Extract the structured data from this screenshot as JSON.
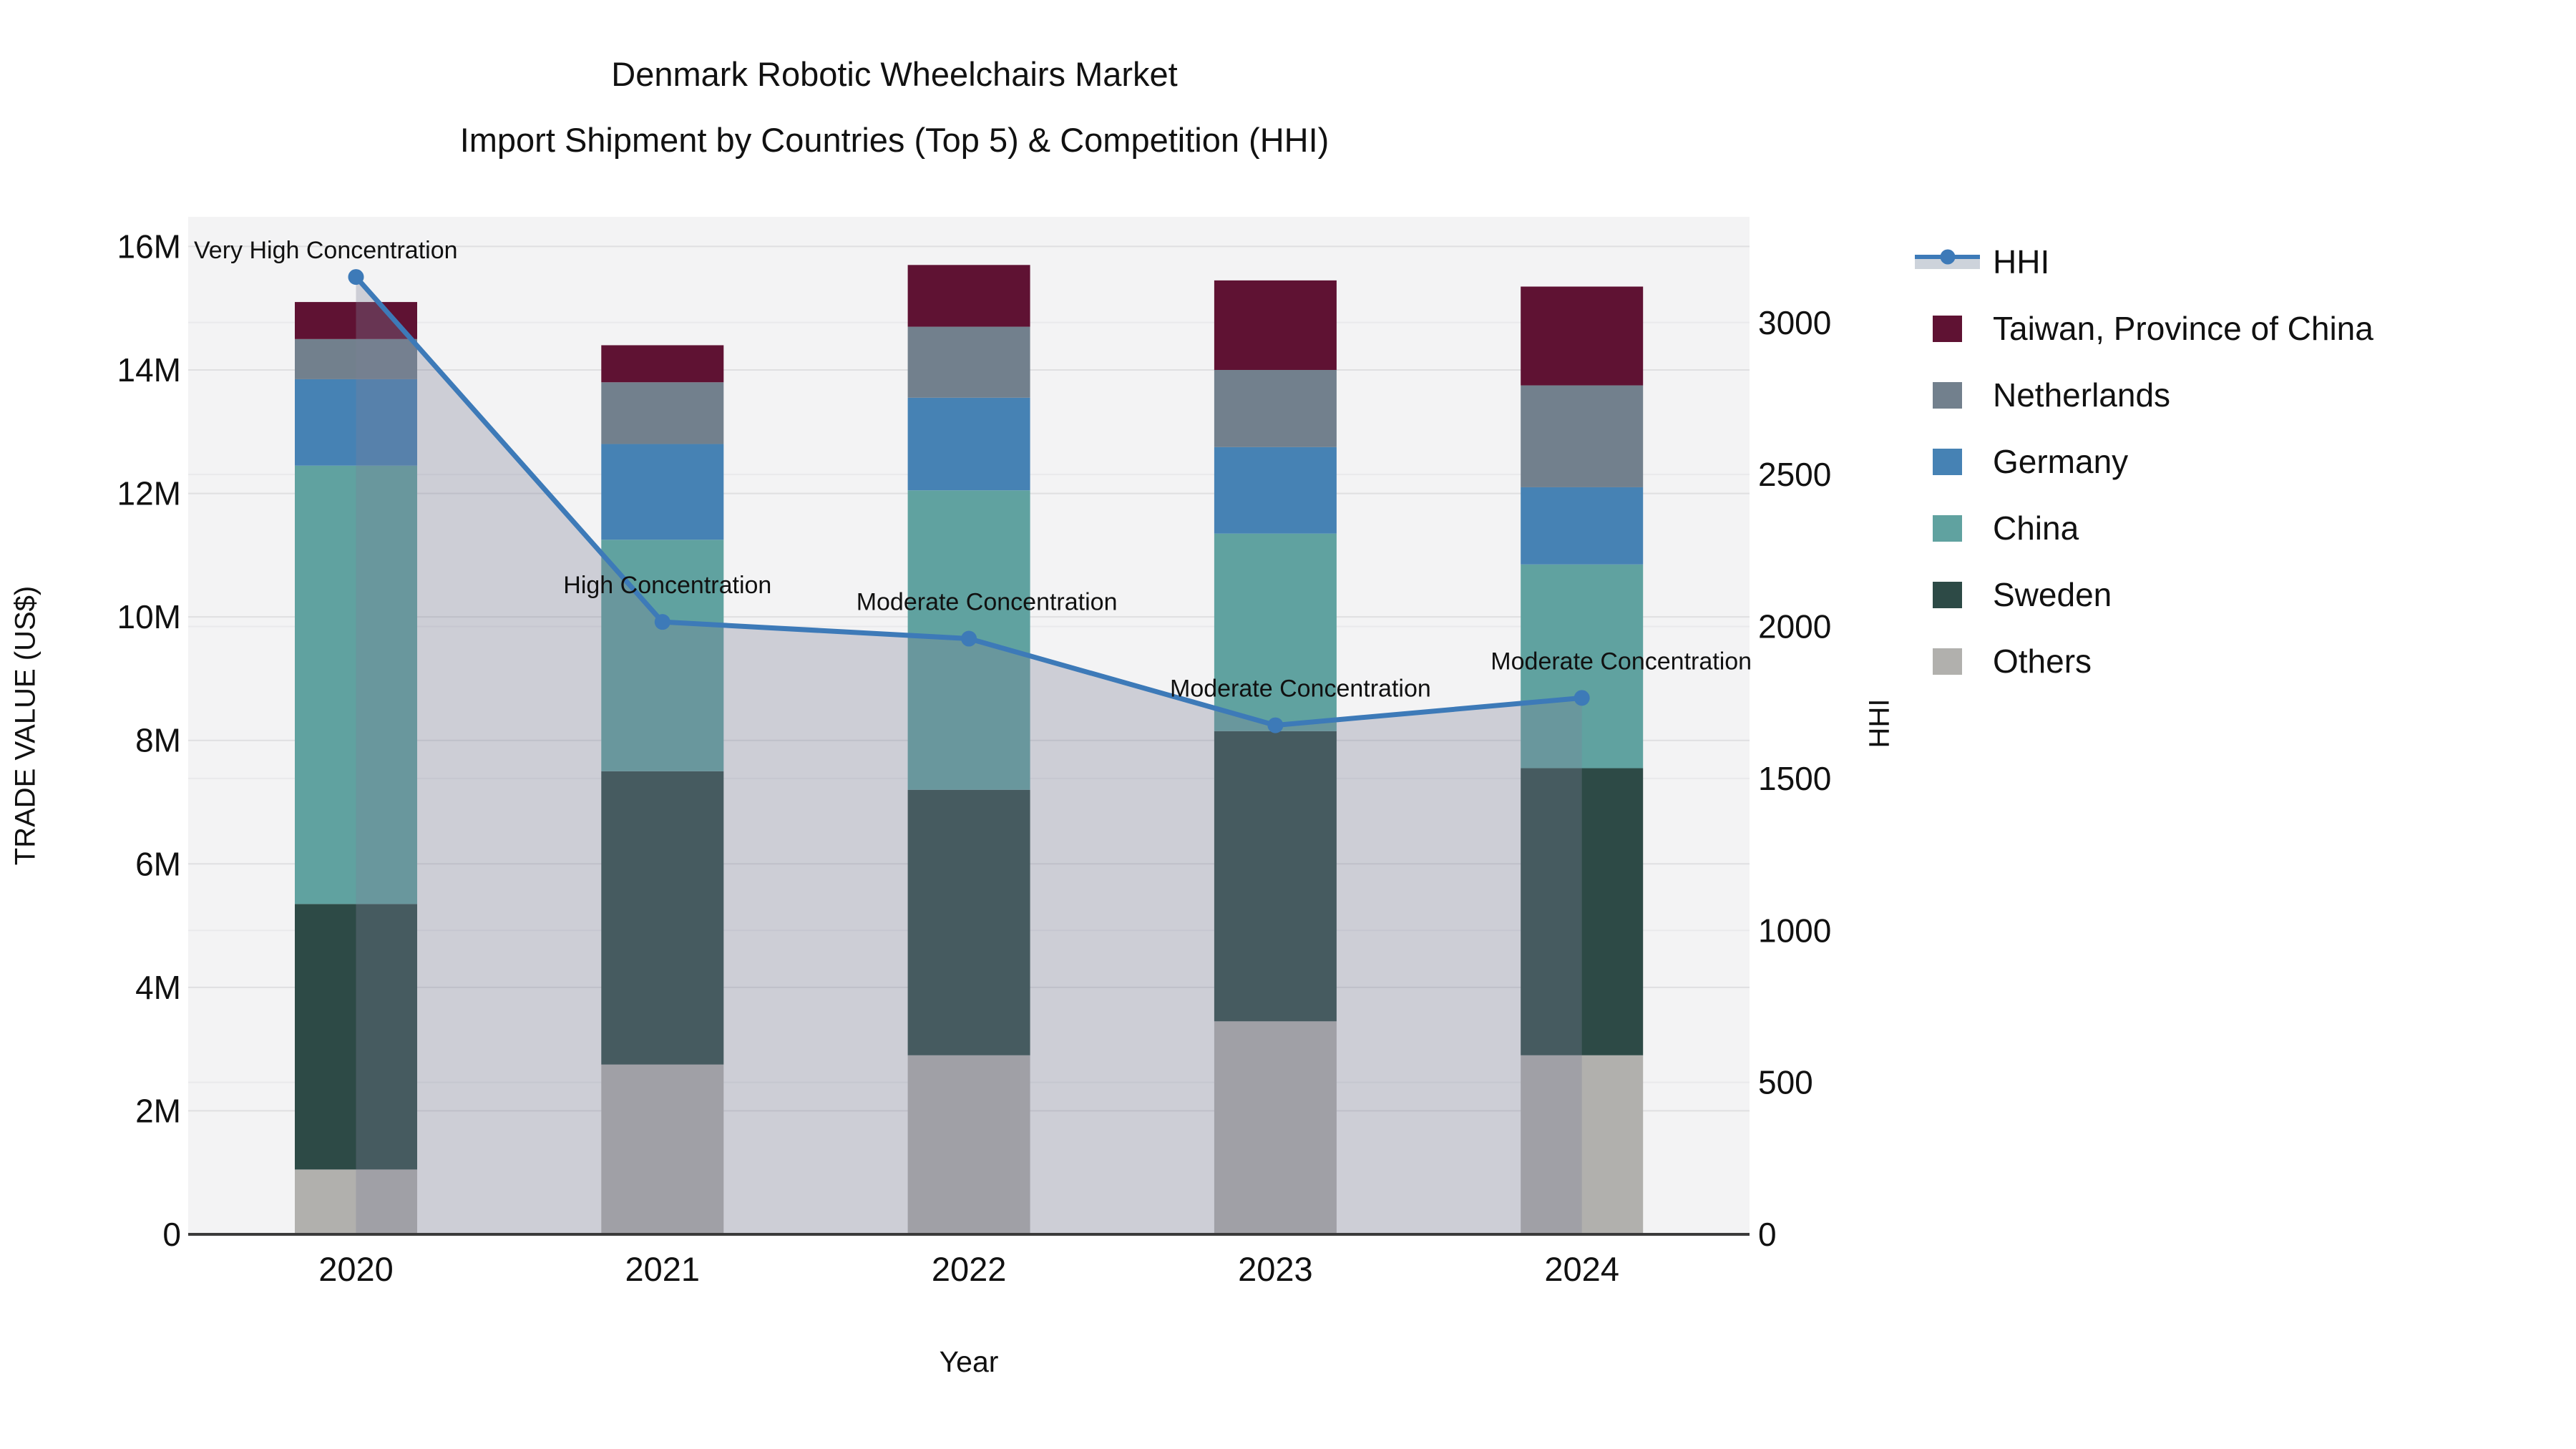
{
  "title": {
    "line1": "Denmark Robotic Wheelchairs Market",
    "line2": "Import Shipment by Countries (Top 5) & Competition (HHI)"
  },
  "y_left": {
    "title": "TRADE VALUE (US$)",
    "tick_labels": [
      "0",
      "2M",
      "4M",
      "6M",
      "8M",
      "10M",
      "12M",
      "14M",
      "16M"
    ],
    "tick_values_millions": [
      0,
      2,
      4,
      6,
      8,
      10,
      12,
      14,
      16
    ],
    "range_millions": [
      0,
      16.48
    ]
  },
  "y_right": {
    "title": "HHI",
    "tick_labels": [
      "0",
      "500",
      "1000",
      "1500",
      "2000",
      "2500",
      "3000"
    ],
    "tick_values": [
      0,
      500,
      1000,
      1500,
      2000,
      2500,
      3000
    ],
    "range": [
      0,
      3348
    ]
  },
  "x_axis": {
    "title": "Year",
    "categories": [
      "2020",
      "2021",
      "2022",
      "2023",
      "2024"
    ]
  },
  "legend": {
    "items": [
      {
        "label": "HHI",
        "type": "line",
        "color": "#3d7ab8"
      },
      {
        "label": "Taiwan, Province of China",
        "type": "bar",
        "color": "#5f1233"
      },
      {
        "label": "Netherlands",
        "type": "bar",
        "color": "#72808d"
      },
      {
        "label": "Germany",
        "type": "bar",
        "color": "#4682b4"
      },
      {
        "label": "China",
        "type": "bar",
        "color": "#60a2a0"
      },
      {
        "label": "Sweden",
        "type": "bar",
        "color": "#2d4a46"
      },
      {
        "label": "Others",
        "type": "bar",
        "color": "#b1b0ad"
      }
    ]
  },
  "annotations": [
    {
      "category": "2020",
      "text": "Very High Concentration",
      "align": "left"
    },
    {
      "category": "2021",
      "text": "High Concentration",
      "align": "center"
    },
    {
      "category": "2022",
      "text": "Moderate Concentration",
      "align": "center"
    },
    {
      "category": "2023",
      "text": "Moderate Concentration",
      "align": "center"
    },
    {
      "category": "2024",
      "text": "Moderate Concentration",
      "align": "center"
    }
  ],
  "chart_data": {
    "type": "bar",
    "subtype": "stacked-bars-with-dual-axis-line",
    "title": "Denmark Robotic Wheelchairs Market — Import Shipment by Countries (Top 5) & Competition (HHI)",
    "xlabel": "Year",
    "ylabel_left": "TRADE VALUE (US$)",
    "ylabel_right": "HHI",
    "categories": [
      "2020",
      "2021",
      "2022",
      "2023",
      "2024"
    ],
    "bar_unit": "US$ millions",
    "grid": "on",
    "legend_position": "right-outside",
    "bar_series_bottom_to_top": [
      {
        "name": "Others",
        "color": "#b1b0ad",
        "values": [
          1.05,
          2.75,
          2.9,
          3.45,
          2.9
        ]
      },
      {
        "name": "Sweden",
        "color": "#2d4a46",
        "values": [
          4.3,
          4.75,
          4.3,
          4.7,
          4.65
        ]
      },
      {
        "name": "China",
        "color": "#60a2a0",
        "values": [
          7.1,
          3.75,
          4.85,
          3.2,
          3.3
        ]
      },
      {
        "name": "Germany",
        "color": "#4682b4",
        "values": [
          1.4,
          1.55,
          1.5,
          1.4,
          1.25
        ]
      },
      {
        "name": "Netherlands",
        "color": "#72808d",
        "values": [
          0.65,
          1.0,
          1.15,
          1.25,
          1.65
        ]
      },
      {
        "name": "Taiwan, Province of China",
        "color": "#5f1233",
        "values": [
          0.6,
          0.6,
          1.0,
          1.45,
          1.6
        ]
      }
    ],
    "stack_totals_millions": [
      15.1,
      14.4,
      15.7,
      15.45,
      15.35
    ],
    "line_series": {
      "name": "HHI",
      "axis": "right",
      "values": [
        3150,
        2015,
        1960,
        1675,
        1765
      ],
      "color": "#3d7ab8",
      "area_fill": "rgba(125,128,153,0.32)",
      "markers": "circle"
    },
    "ylim_left_millions": [
      0,
      16.48
    ],
    "ylim_right": [
      0,
      3348
    ]
  }
}
